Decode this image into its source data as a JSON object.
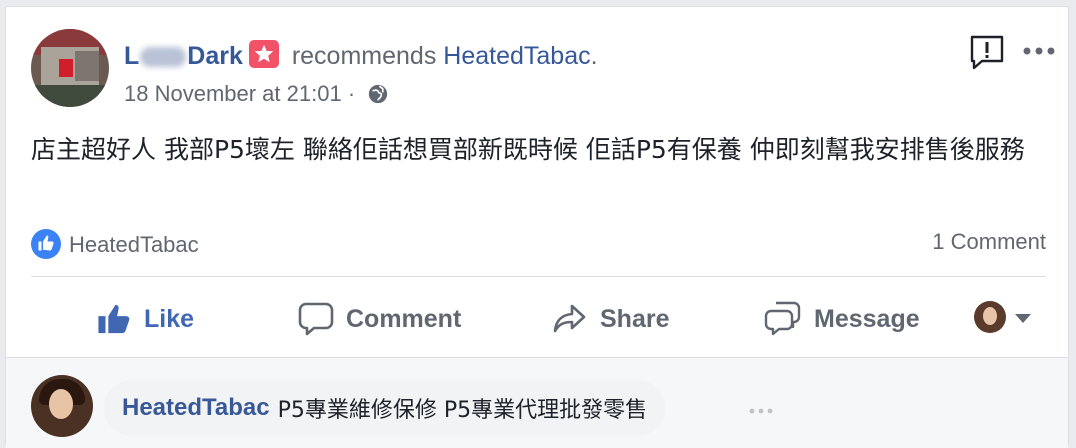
{
  "post": {
    "author_first": "L",
    "author_last": "Dark",
    "action_text": "recommends",
    "page_name": "HeatedTabac",
    "page_suffix": ".",
    "timestamp": "18 November at 21:01",
    "timestamp_sep": "·",
    "body": "店主超好人 我部P5壞左 聯絡佢話想買部新既時候 佢話P5有保養 仲即刻幫我安排售後服務"
  },
  "reactions": {
    "liker_name": "HeatedTabac",
    "comment_count": "1 Comment"
  },
  "actions": {
    "like": "Like",
    "comment": "Comment",
    "share": "Share",
    "message": "Message"
  },
  "comment": {
    "author": "HeatedTabac",
    "text": "P5專業維修保修 P5專業代理批發零售"
  },
  "colors": {
    "link": "#365899",
    "like_active": "#4267b2",
    "recommend_badge": "#f25268",
    "like_badge": "#3b82f6"
  },
  "icons": [
    "report-icon",
    "more-options-icon",
    "globe-icon",
    "recommend-star-icon",
    "like-icon",
    "comment-icon",
    "share-icon",
    "message-icon",
    "caret-down-icon"
  ]
}
